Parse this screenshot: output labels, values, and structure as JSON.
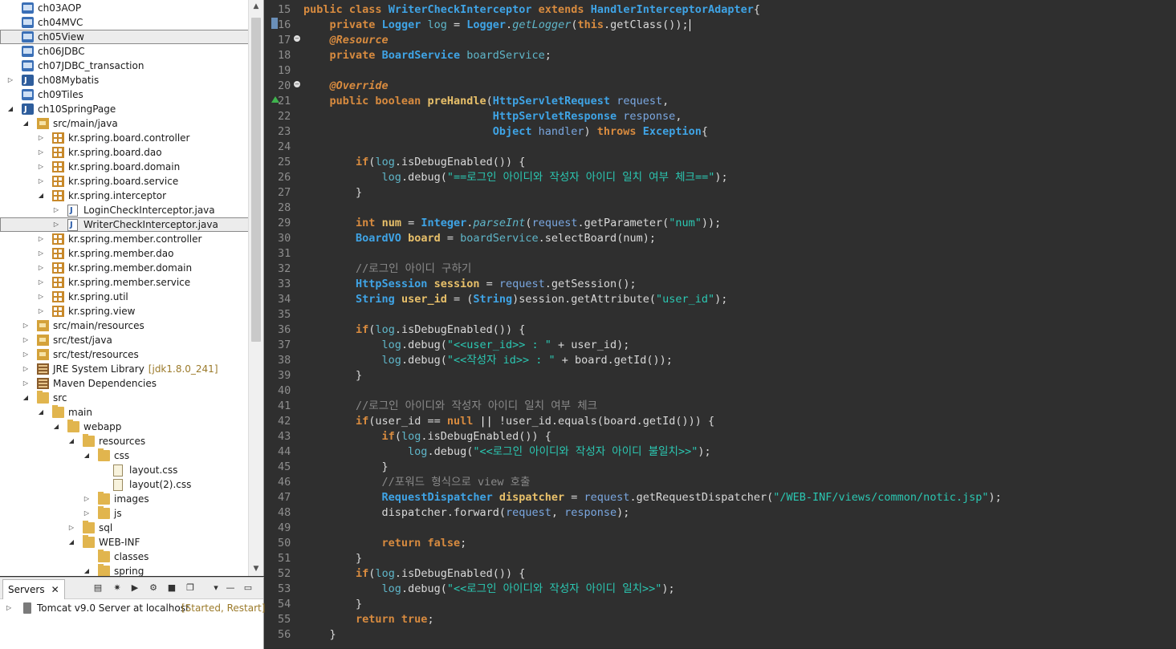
{
  "explorer": {
    "items": [
      {
        "label": "ch03AOP",
        "icon": "project-icon",
        "depth": 0,
        "twisty": "",
        "decor": ""
      },
      {
        "label": "ch04MVC",
        "icon": "project-icon",
        "depth": 0,
        "twisty": "",
        "decor": ""
      },
      {
        "label": "ch05View",
        "icon": "project-icon",
        "depth": 0,
        "twisty": "",
        "decor": "",
        "selected": true
      },
      {
        "label": "ch06JDBC",
        "icon": "project-icon",
        "depth": 0,
        "twisty": "",
        "decor": ""
      },
      {
        "label": "ch07JDBC_transaction",
        "icon": "project-icon",
        "depth": 0,
        "twisty": "",
        "decor": ""
      },
      {
        "label": "ch08Mybatis",
        "icon": "java-project-icon",
        "depth": 0,
        "twisty": "▷",
        "decor": ""
      },
      {
        "label": "ch09Tiles",
        "icon": "project-icon",
        "depth": 0,
        "twisty": "",
        "decor": ""
      },
      {
        "label": "ch10SpringPage",
        "icon": "java-project-icon",
        "depth": 0,
        "twisty": "◢",
        "decor": ""
      },
      {
        "label": "src/main/java",
        "icon": "source-folder-icon",
        "depth": 1,
        "twisty": "◢",
        "decor": ""
      },
      {
        "label": "kr.spring.board.controller",
        "icon": "package-icon",
        "depth": 2,
        "twisty": "▷",
        "decor": ""
      },
      {
        "label": "kr.spring.board.dao",
        "icon": "package-icon",
        "depth": 2,
        "twisty": "▷",
        "decor": ""
      },
      {
        "label": "kr.spring.board.domain",
        "icon": "package-icon",
        "depth": 2,
        "twisty": "▷",
        "decor": ""
      },
      {
        "label": "kr.spring.board.service",
        "icon": "package-icon",
        "depth": 2,
        "twisty": "▷",
        "decor": ""
      },
      {
        "label": "kr.spring.interceptor",
        "icon": "package-icon",
        "depth": 2,
        "twisty": "◢",
        "decor": ""
      },
      {
        "label": "LoginCheckInterceptor.java",
        "icon": "java-file-icon",
        "depth": 3,
        "twisty": "▷",
        "decor": ""
      },
      {
        "label": "WriterCheckInterceptor.java",
        "icon": "java-file-icon",
        "depth": 3,
        "twisty": "▷",
        "decor": "",
        "selected": true
      },
      {
        "label": "kr.spring.member.controller",
        "icon": "package-icon",
        "depth": 2,
        "twisty": "▷",
        "decor": ""
      },
      {
        "label": "kr.spring.member.dao",
        "icon": "package-icon",
        "depth": 2,
        "twisty": "▷",
        "decor": ""
      },
      {
        "label": "kr.spring.member.domain",
        "icon": "package-icon",
        "depth": 2,
        "twisty": "▷",
        "decor": ""
      },
      {
        "label": "kr.spring.member.service",
        "icon": "package-icon",
        "depth": 2,
        "twisty": "▷",
        "decor": ""
      },
      {
        "label": "kr.spring.util",
        "icon": "package-icon",
        "depth": 2,
        "twisty": "▷",
        "decor": ""
      },
      {
        "label": "kr.spring.view",
        "icon": "package-icon",
        "depth": 2,
        "twisty": "▷",
        "decor": ""
      },
      {
        "label": "src/main/resources",
        "icon": "source-folder-icon",
        "depth": 1,
        "twisty": "▷",
        "decor": ""
      },
      {
        "label": "src/test/java",
        "icon": "source-folder-icon",
        "depth": 1,
        "twisty": "▷",
        "decor": ""
      },
      {
        "label": "src/test/resources",
        "icon": "source-folder-icon",
        "depth": 1,
        "twisty": "▷",
        "decor": ""
      },
      {
        "label": "JRE System Library",
        "icon": "library-icon",
        "depth": 1,
        "twisty": "▷",
        "decor": "[jdk1.8.0_241]"
      },
      {
        "label": "Maven Dependencies",
        "icon": "library-icon",
        "depth": 1,
        "twisty": "▷",
        "decor": ""
      },
      {
        "label": "src",
        "icon": "folder-icon",
        "depth": 1,
        "twisty": "◢",
        "decor": ""
      },
      {
        "label": "main",
        "icon": "folder-icon",
        "depth": 2,
        "twisty": "◢",
        "decor": ""
      },
      {
        "label": "webapp",
        "icon": "folder-icon",
        "depth": 3,
        "twisty": "◢",
        "decor": ""
      },
      {
        "label": "resources",
        "icon": "folder-icon",
        "depth": 4,
        "twisty": "◢",
        "decor": ""
      },
      {
        "label": "css",
        "icon": "folder-icon",
        "depth": 5,
        "twisty": "◢",
        "decor": ""
      },
      {
        "label": "layout.css",
        "icon": "css-file-icon",
        "depth": 6,
        "twisty": "",
        "decor": ""
      },
      {
        "label": "layout(2).css",
        "icon": "css-file-icon",
        "depth": 6,
        "twisty": "",
        "decor": ""
      },
      {
        "label": "images",
        "icon": "folder-icon",
        "depth": 5,
        "twisty": "▷",
        "decor": ""
      },
      {
        "label": "js",
        "icon": "folder-icon",
        "depth": 5,
        "twisty": "▷",
        "decor": ""
      },
      {
        "label": "sql",
        "icon": "folder-icon",
        "depth": 4,
        "twisty": "▷",
        "decor": ""
      },
      {
        "label": "WEB-INF",
        "icon": "folder-icon",
        "depth": 4,
        "twisty": "◢",
        "decor": ""
      },
      {
        "label": "classes",
        "icon": "folder-icon",
        "depth": 5,
        "twisty": "",
        "decor": ""
      },
      {
        "label": "spring",
        "icon": "folder-icon",
        "depth": 5,
        "twisty": "◢",
        "decor": ""
      }
    ]
  },
  "servers": {
    "tab_label": "Servers",
    "close_glyph": "✕",
    "toolbar_glyphs": [
      "▤",
      "✷",
      "▶",
      "⚙",
      "■",
      "❐",
      "▾",
      "—",
      "▭"
    ],
    "entry_label": "Tomcat v9.0 Server at localhost",
    "entry_status": "[Started, Restart]",
    "twisty": "▷"
  },
  "editor": {
    "lines": [
      {
        "n": "15",
        "html": "<span class='k'>public class</span> <span class='t'>WriterCheckInterceptor</span> <span class='k'>extends</span> <span class='t'>HandlerInterceptorAdapter</span>{"
      },
      {
        "n": "16",
        "html": "    <span class='k'>private</span> <span class='t'>Logger</span> <span class='f'>log</span> = <span class='t'>Logger</span>.<span class='i'>getLogger</span>(<span class='k'>this</span>.getClass());<span class='caret'></span>"
      },
      {
        "n": "17",
        "html": "    <span class='a'>@Resource</span>"
      },
      {
        "n": "18",
        "html": "    <span class='k'>private</span> <span class='t'>BoardService</span> <span class='f'>boardService</span>;"
      },
      {
        "n": "19",
        "html": ""
      },
      {
        "n": "20",
        "html": "    <span class='a'>@Override</span>"
      },
      {
        "n": "21",
        "html": "    <span class='k'>public boolean</span> <span class='v'>preHandle</span>(<span class='t'>HttpServletRequest</span> <span class='p'>request</span>,"
      },
      {
        "n": "22",
        "html": "                             <span class='t'>HttpServletResponse</span> <span class='p'>response</span>,"
      },
      {
        "n": "23",
        "html": "                             <span class='t'>Object</span> <span class='p'>handler</span>) <span class='k'>throws</span> <span class='t'>Exception</span>{"
      },
      {
        "n": "24",
        "html": ""
      },
      {
        "n": "25",
        "html": "        <span class='k'>if</span>(<span class='f'>log</span>.isDebugEnabled()) {"
      },
      {
        "n": "26",
        "html": "            <span class='f'>log</span>.debug(<span class='s'>\"==로그인 아이디와 작성자 아이디 일치 여부 체크==\"</span>);"
      },
      {
        "n": "27",
        "html": "        }"
      },
      {
        "n": "28",
        "html": ""
      },
      {
        "n": "29",
        "html": "        <span class='k'>int</span> <span class='v'>num</span> = <span class='t'>Integer</span>.<span class='i'>parseInt</span>(<span class='p'>request</span>.getParameter(<span class='s'>\"num\"</span>));"
      },
      {
        "n": "30",
        "html": "        <span class='t'>BoardVO</span> <span class='v'>board</span> = <span class='f'>boardService</span>.selectBoard(num);"
      },
      {
        "n": "31",
        "html": ""
      },
      {
        "n": "32",
        "html": "        <span class='c'>//로그인 아이디 구하기</span>"
      },
      {
        "n": "33",
        "html": "        <span class='t'>HttpSession</span> <span class='v'>session</span> = <span class='p'>request</span>.getSession();"
      },
      {
        "n": "34",
        "html": "        <span class='t'>String</span> <span class='v'>user_id</span> = (<span class='t'>String</span>)session.getAttribute(<span class='s'>\"user_id\"</span>);"
      },
      {
        "n": "35",
        "html": ""
      },
      {
        "n": "36",
        "html": "        <span class='k'>if</span>(<span class='f'>log</span>.isDebugEnabled()) {"
      },
      {
        "n": "37",
        "html": "            <span class='f'>log</span>.debug(<span class='s'>\"&lt;&lt;user_id&gt;&gt; : \"</span> + user_id);"
      },
      {
        "n": "38",
        "html": "            <span class='f'>log</span>.debug(<span class='s'>\"&lt;&lt;작성자 id&gt;&gt; : \"</span> + board.getId());"
      },
      {
        "n": "39",
        "html": "        }"
      },
      {
        "n": "40",
        "html": ""
      },
      {
        "n": "41",
        "html": "        <span class='c'>//로그인 아이디와 작성자 아이디 일치 여부 체크</span>"
      },
      {
        "n": "42",
        "html": "        <span class='k'>if</span>(user_id == <span class='k'>null</span> <span class='bk'>||</span> !user_id.equals(board.getId())) {"
      },
      {
        "n": "43",
        "html": "            <span class='k'>if</span>(<span class='f'>log</span>.isDebugEnabled()) {"
      },
      {
        "n": "44",
        "html": "                <span class='f'>log</span>.debug(<span class='s'>\"&lt;&lt;로그인 아이디와 작성자 아이디 불일치&gt;&gt;\"</span>);"
      },
      {
        "n": "45",
        "html": "            }"
      },
      {
        "n": "46",
        "html": "            <span class='c'>//포워드 형식으로 view 호출</span>"
      },
      {
        "n": "47",
        "html": "            <span class='t'>RequestDispatcher</span> <span class='v'>dispatcher</span> = <span class='p'>request</span>.getRequestDispatcher(<span class='s'>\"/WEB-INF/views/common/notic.jsp\"</span>);"
      },
      {
        "n": "48",
        "html": "            dispatcher.forward(<span class='p'>request</span>, <span class='p'>response</span>);"
      },
      {
        "n": "49",
        "html": ""
      },
      {
        "n": "50",
        "html": "            <span class='k'>return false</span>;"
      },
      {
        "n": "51",
        "html": "        }"
      },
      {
        "n": "52",
        "html": "        <span class='k'>if</span>(<span class='f'>log</span>.isDebugEnabled()) {"
      },
      {
        "n": "53",
        "html": "            <span class='f'>log</span>.debug(<span class='s'>\"&lt;&lt;로그인 아이디와 작성자 아이디 일치&gt;&gt;\"</span>);"
      },
      {
        "n": "54",
        "html": "        }"
      },
      {
        "n": "55",
        "html": "        <span class='k'>return true</span>;"
      },
      {
        "n": "56",
        "html": "    }"
      }
    ]
  }
}
